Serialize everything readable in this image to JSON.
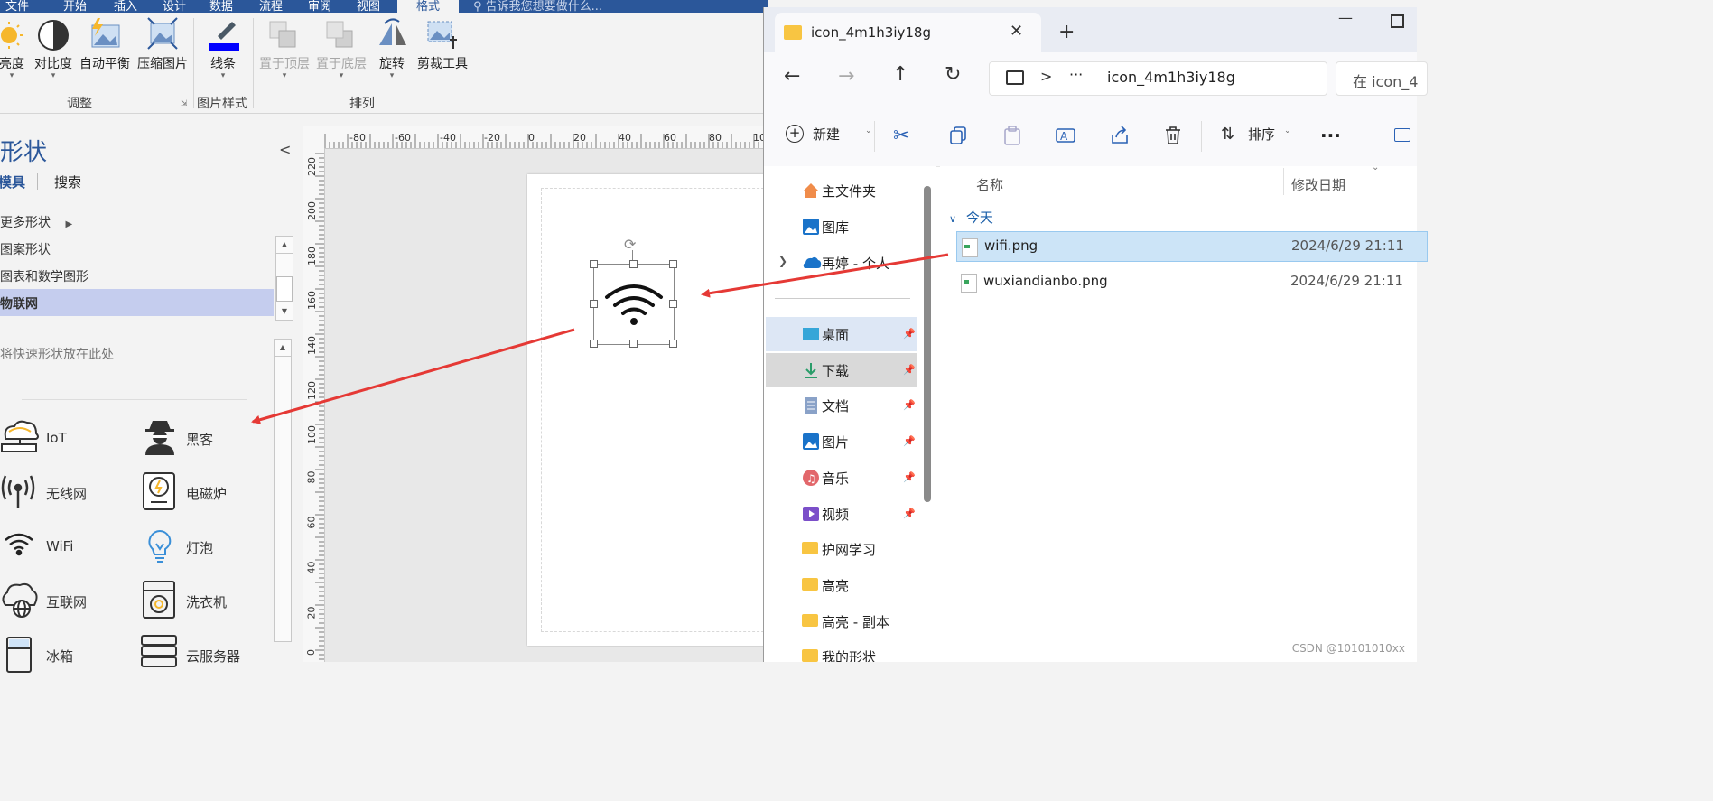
{
  "visio": {
    "menu": [
      {
        "label": "文件"
      },
      {
        "label": "开始"
      },
      {
        "label": "插入"
      },
      {
        "label": "设计"
      },
      {
        "label": "数据"
      },
      {
        "label": "流程"
      },
      {
        "label": "审阅"
      },
      {
        "label": "视图"
      },
      {
        "label": "格式"
      }
    ],
    "tell_me_placeholder": "告诉我您想要做什么...",
    "ribbon": {
      "adjust_buttons": [
        "亮度",
        "对比度",
        "自动平衡",
        "压缩图片"
      ],
      "adjust_group": "调整",
      "line_button": "线条",
      "picture_style_group": "图片样式",
      "arrange_buttons": [
        "置于顶层",
        "置于底层",
        "旋转",
        "剪裁工具"
      ],
      "arrange_group": "排列"
    },
    "shapes_panel": {
      "title": "形状",
      "tabs": [
        "模具",
        "搜索"
      ],
      "stencils": [
        "更多形状",
        "图案形状",
        "图表和数学图形",
        "物联网"
      ],
      "quick_shapes_hint": "将快速形状放在此处",
      "shapes": [
        "IoT",
        "黑客",
        "无线网",
        "电磁炉",
        "WiFi",
        "灯泡",
        "互联网",
        "洗衣机",
        "冰箱",
        "云服务器"
      ]
    },
    "ruler_h": [
      "-80",
      "-60",
      "-40",
      "-20",
      "0",
      "20",
      "40",
      "60",
      "80",
      "10"
    ],
    "ruler_v": [
      "220",
      "200",
      "180",
      "160",
      "140",
      "120",
      "100",
      "80",
      "60",
      "40",
      "20",
      "0"
    ],
    "collapse_glyph": "<"
  },
  "explorer": {
    "tab_title": "icon_4m1h3iy18g",
    "new_tab": "+",
    "breadcrumb_more": "···",
    "breadcrumb_sep": ">",
    "path": "icon_4m1h3iy18g",
    "search_placeholder": "在 icon_4",
    "toolbar": {
      "new_label": "新建",
      "sort_label": "排序",
      "more": "···"
    },
    "nav": [
      {
        "label": "主文件夹",
        "icon": "home-icon"
      },
      {
        "label": "图库",
        "icon": "gallery-icon"
      },
      {
        "label": "再婷 - 个人",
        "icon": "onedrive-icon"
      },
      {
        "label": "桌面",
        "icon": "desktop-icon"
      },
      {
        "label": "下载",
        "icon": "download-icon"
      },
      {
        "label": "文档",
        "icon": "document-icon"
      },
      {
        "label": "图片",
        "icon": "pictures-icon"
      },
      {
        "label": "音乐",
        "icon": "music-icon"
      },
      {
        "label": "视频",
        "icon": "video-icon"
      },
      {
        "label": "护网学习",
        "icon": "folder-icon"
      },
      {
        "label": "高亮",
        "icon": "folder-icon"
      },
      {
        "label": "高亮 - 副本",
        "icon": "folder-icon"
      },
      {
        "label": "我的形状",
        "icon": "folder-icon"
      }
    ],
    "columns": [
      "名称",
      "修改日期"
    ],
    "group_label": "今天",
    "files": [
      {
        "name": "wifi.png",
        "date": "2024/6/29 21:11"
      },
      {
        "name": "wuxiandianbo.png",
        "date": "2024/6/29 21:11"
      }
    ]
  },
  "watermark": "CSDN @10101010xx",
  "colors": {
    "accent": "#2b579a",
    "arrow": "#e53935",
    "selection": "#cce4f7"
  }
}
